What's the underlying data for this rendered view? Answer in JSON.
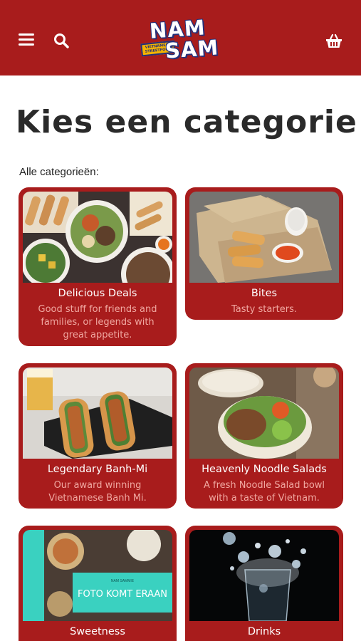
{
  "header": {
    "brand_line1": "NAM",
    "brand_line2": "SAM",
    "brand_tagline": "VIETNAMESE STREETFOOD",
    "brand_color": "#a81c1c",
    "menu_icon": "hamburger-menu-icon",
    "search_icon": "search-icon",
    "cart_icon": "shopping-basket-icon"
  },
  "page": {
    "title": "Kies een categorie",
    "section_label": "Alle categorieën:"
  },
  "categories": [
    {
      "name": "Delicious Deals",
      "description": "Good stuff for friends and families, or legends with great appetite."
    },
    {
      "name": "Bites",
      "description": "Tasty starters."
    },
    {
      "name": "Legendary Banh-Mi",
      "description": "Our award winning Vietnamese Banh Mi."
    },
    {
      "name": "Heavenly Noodle Salads",
      "description": "A fresh Noodle Salad bowl with a taste of Vietnam."
    },
    {
      "name": "Sweetness",
      "description": "",
      "placeholder_small": "NAM SAMMIE",
      "placeholder_text": "FOTO KOMT ERAAN"
    },
    {
      "name": "Drinks",
      "description": ""
    }
  ]
}
